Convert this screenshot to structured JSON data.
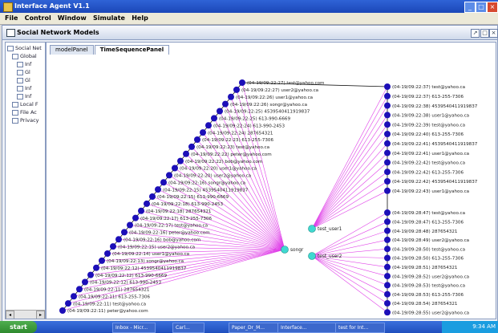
{
  "window": {
    "title": "Interface Agent V1.1"
  },
  "menu": [
    "File",
    "Control",
    "Window",
    "Simulate",
    "Help"
  ],
  "inner_window": {
    "title": "Social Network Models"
  },
  "sidebar": {
    "items": [
      {
        "label": "Social Net",
        "indent": 0
      },
      {
        "label": "Global",
        "indent": 1
      },
      {
        "label": "Inf",
        "indent": 2
      },
      {
        "label": "Gl",
        "indent": 2
      },
      {
        "label": "Gl",
        "indent": 2
      },
      {
        "label": "Inf",
        "indent": 2
      },
      {
        "label": "Inf",
        "indent": 2
      },
      {
        "label": "Local F",
        "indent": 1
      },
      {
        "label": "File Ac",
        "indent": 1
      },
      {
        "label": "Privacy",
        "indent": 1
      }
    ]
  },
  "tabs": [
    {
      "label": "modelPanel",
      "active": false
    },
    {
      "label": "TimeSequencePanel",
      "active": true
    }
  ],
  "graph": {
    "hub_nodes": [
      {
        "id": "songr",
        "label": "songr"
      },
      {
        "id": "test_user1",
        "label": "test_user1"
      },
      {
        "id": "test_user2",
        "label": "test_user2"
      }
    ],
    "left_nodes": [
      "(04-19/09:22:27) test@yahoo.com",
      "(04-19/09:22:27) user2@yahoo.ca",
      "(04-19/09:22:26) user1@yahoo.ca",
      "(04-19/09:22:26) songr@yahoo.ca",
      "(04-19/09:22:25) 4539540411919837",
      "(04-19/09:22:25) 613-990-6669",
      "(04-19/09:22:24) 613-990-2453",
      "(04-19/09:22:24) 287654321",
      "(04-19/09:22:23) 613-255-7306",
      "(04-19/09:22:23) test@yahoo.ca",
      "(04-19/09:22:22) peter@yahoo.com",
      "(04-19/09:22:22) bob@yahoo.com",
      "(04-19/09:22:20) user1@yahoo.ca",
      "(04-19/09:22:20) user2@yahoo.ca",
      "(04-19/09:22:16) songr@yahoo.ca",
      "(04-19/09:22:15) 4539540411919837",
      "(04-19/09:22:15) 613-990-6669",
      "(04-19/09:22:18) 613-990-2453",
      "(04-19/09:22:18) 287654321",
      "(04-19/09:22:17) 613-255-7306",
      "(04-19/09:22:17) test@yahoo.ca",
      "(04-19/09:22:16) peter@yahoo.com",
      "(04-19/09:22:16) bob@yahoo.com",
      "(04-19/09:22:15) user2@yahoo.ca",
      "(04-19/09:22:14) user1@yahoo.ca",
      "(04-19/09:22:13) songr@yahoo.ca",
      "(04-19/09:22:12) 4539540411919837",
      "(04-19/09:22:12) 613-990-6669",
      "(04-19/09:22:12) 613-990-2453",
      "(04-19/09:22:11) 287654321",
      "(04-19/09:22:11) 613-255-7306",
      "(04-19/09:22:11) test@yahoo.ca",
      "(04-19/09:22:11) peter@yahoo.com"
    ],
    "right_upper_nodes": [
      "(04-19/09:22:37) test@yahoo.ca",
      "(04-19/09:22:37) 613-255-7306",
      "(04-19/09:22:38) 4539540411919837",
      "(04-19/09:22:38) user1@yahoo.ca",
      "(04-19/09:22:39) test@yahoo.ca",
      "(04-19/09:22:40) 613-255-7306",
      "(04-19/09:22:41) 4539540411919837",
      "(04-19/09:22:41) user1@yahoo.ca",
      "(04-19/09:22:42) test@yahoo.ca",
      "(04-19/09:22:42) 613-255-7306",
      "(04-19/09:22:42) 4539540411919837",
      "(04-19/09:22:43) user1@yahoo.ca"
    ],
    "right_lower_nodes": [
      "(04-19/09:28:47) test@yahoo.ca",
      "(04-19/09:28:47) 613-255-7306",
      "(04-19/09:28:48) 287654321",
      "(04-19/09:28:49) user2@yahoo.ca",
      "(04-19/09:28:50) test@yahoo.ca",
      "(04-19/09:28:50) 613-255-7306",
      "(04-19/09:28:51) 287654321",
      "(04-19/09:28:52) user2@yahoo.ca",
      "(04-19/09:28:53) test@yahoo.ca",
      "(04-19/09:28:53) 613-255-7306",
      "(04-19/09:28:54) 287654321",
      "(04-19/09:28:55) user2@yahoo.ca"
    ],
    "colors": {
      "node": "#1c0fb8",
      "hub": "#3fd9d0",
      "edge": "#e040e8",
      "line": "#111111"
    }
  },
  "taskbar": {
    "start_label": "start",
    "items": [
      "Inbox - Micr...",
      "Carl...",
      "Paper_Dr_M...",
      "Interface...",
      "test for Int..."
    ],
    "clock": "9:34 AM"
  }
}
